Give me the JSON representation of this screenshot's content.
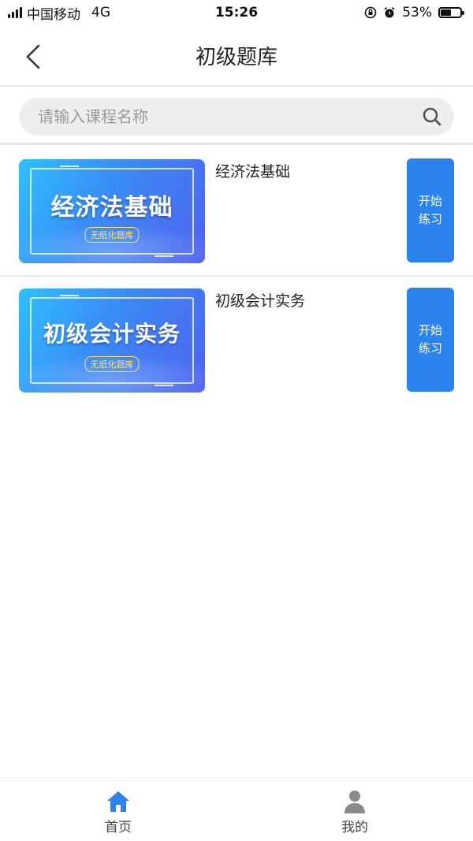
{
  "status_bar": {
    "carrier": "中国移动",
    "network": "4G",
    "time": "15:26",
    "battery": "53%",
    "battery_level": 0.53
  },
  "nav": {
    "title": "初级题库",
    "back_icon": "chevron-left-icon"
  },
  "search": {
    "placeholder": "请输入课程名称",
    "value": "",
    "icon": "search-icon"
  },
  "courses": [
    {
      "cover_title": "经济法基础",
      "cover_badge": "无纸化题库",
      "name": "经济法基础",
      "action_line1": "开始",
      "action_line2": "练习"
    },
    {
      "cover_title": "初级会计实务",
      "cover_badge": "无纸化题库",
      "name": "初级会计实务",
      "action_line1": "开始",
      "action_line2": "练习"
    }
  ],
  "tabs": [
    {
      "label": "首页",
      "icon": "home-icon",
      "active": true
    },
    {
      "label": "我的",
      "icon": "user-icon",
      "active": false
    }
  ],
  "colors": {
    "accent": "#2b84ee",
    "tab_active": "#2b84ee",
    "tab_inactive": "#8a8a8a"
  }
}
